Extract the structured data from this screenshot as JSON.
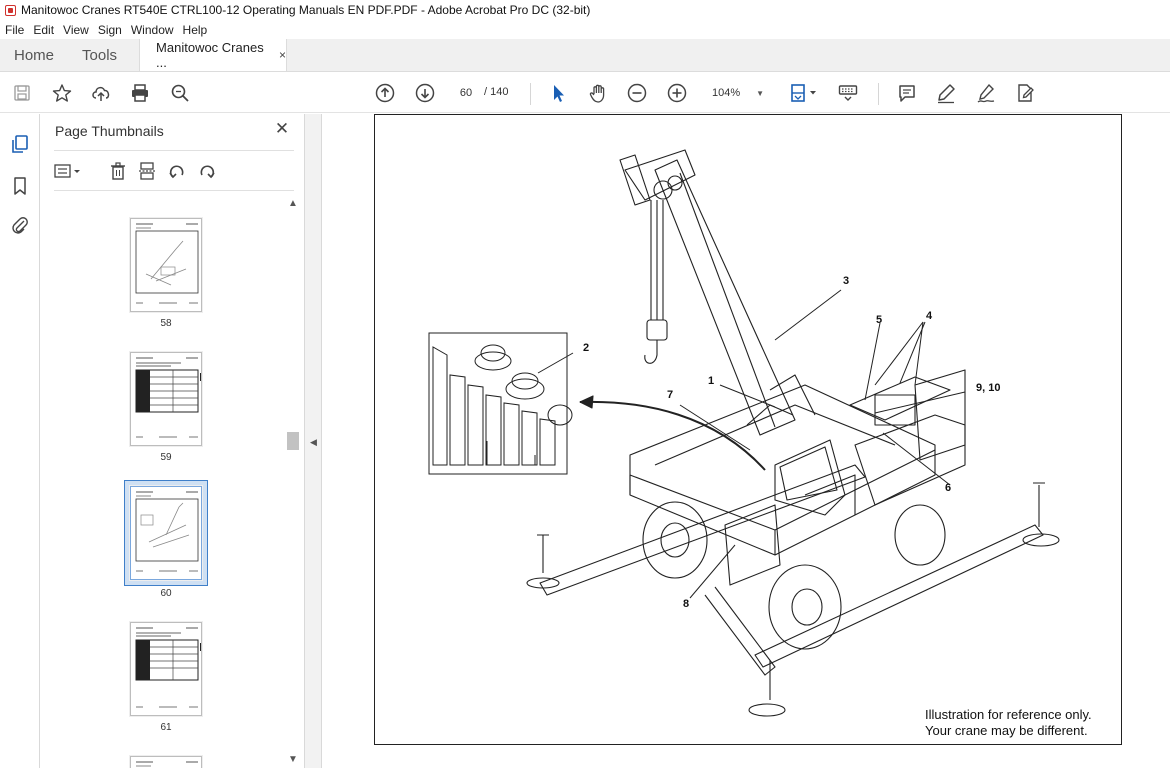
{
  "window": {
    "title": "Manitowoc Cranes RT540E CTRL100-12 Operating Manuals EN PDF.PDF - Adobe Acrobat Pro DC (32-bit)"
  },
  "menu": [
    "File",
    "Edit",
    "View",
    "Sign",
    "Window",
    "Help"
  ],
  "tabs": {
    "home": "Home",
    "tools": "Tools",
    "document": "Manitowoc Cranes ...",
    "close": "×"
  },
  "toolbar": {
    "page_current": "60",
    "page_total": "/ 140",
    "zoom": "104%",
    "icons": [
      "save-icon",
      "bookmark-star-icon",
      "upload-cloud-icon",
      "print-icon",
      "search-zoom-icon",
      "page-up-icon",
      "page-down-icon",
      "select-cursor-icon",
      "hand-pan-icon",
      "zoom-out-icon",
      "zoom-in-icon",
      "fit-page-icon",
      "keyboard-scroll-icon",
      "comment-icon",
      "highlight-pen-icon",
      "sign-icon",
      "fill-sign-icon"
    ]
  },
  "panel": {
    "title": "Page Thumbnails",
    "close": "✕",
    "thumbnails": [
      {
        "number": "58",
        "selected": false
      },
      {
        "number": "59",
        "selected": false
      },
      {
        "number": "60",
        "selected": true
      },
      {
        "number": "61",
        "selected": false
      }
    ]
  },
  "document": {
    "callouts": [
      "1",
      "2",
      "3",
      "4",
      "5",
      "6",
      "7",
      "8",
      "9, 10"
    ],
    "caption_line1": "Illustration for reference only.",
    "caption_line2": "Your crane may be different."
  },
  "colors": {
    "accent": "#3f7fc9",
    "logo": "#d0312d",
    "cursor_blue": "#1a5fb4"
  }
}
